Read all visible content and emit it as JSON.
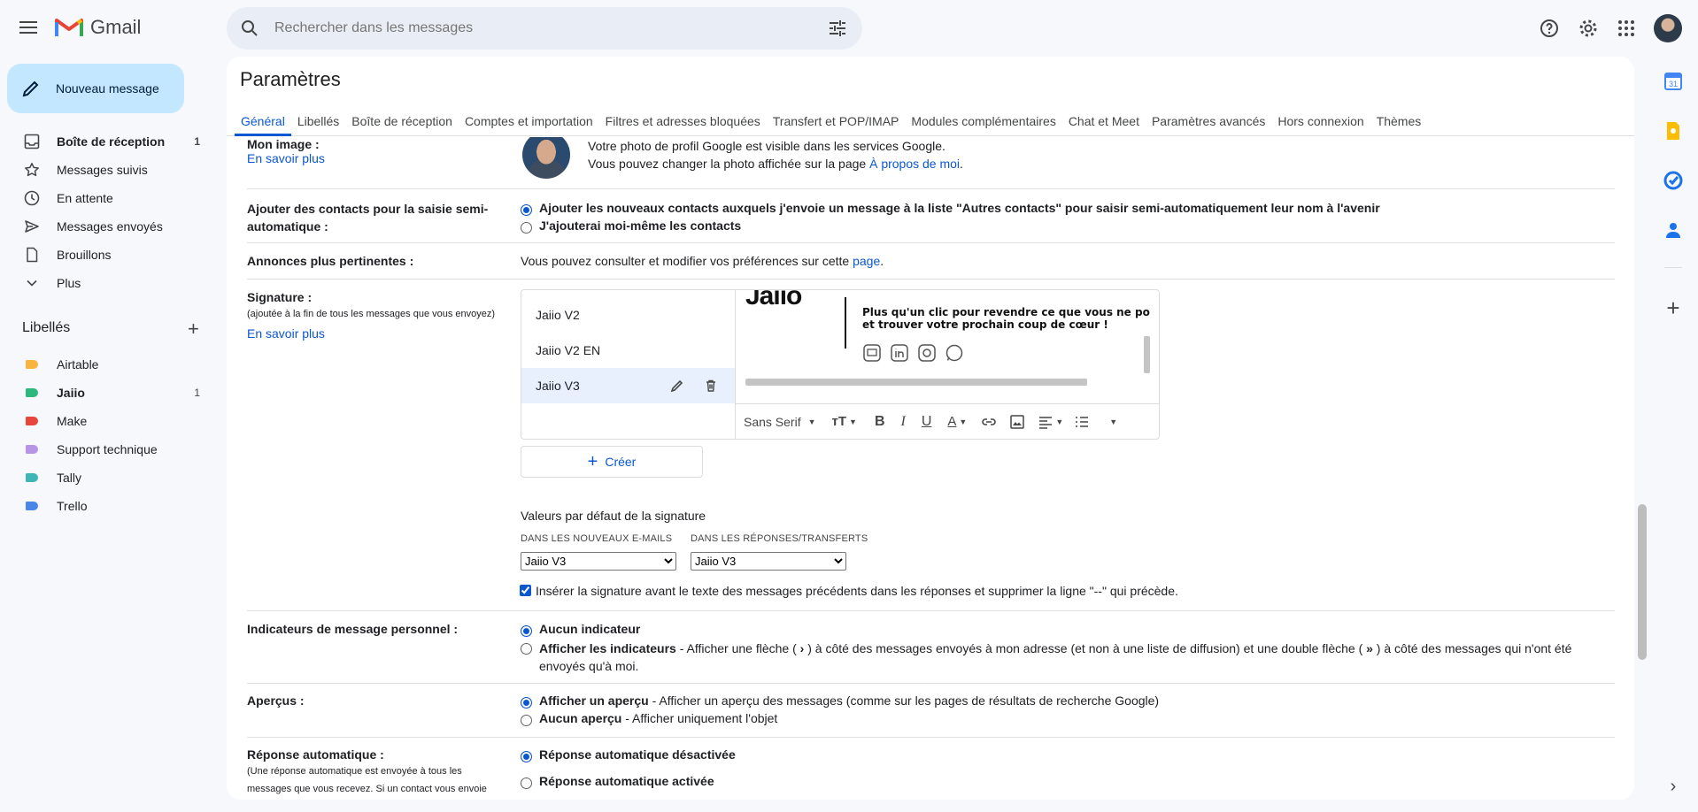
{
  "app": {
    "name": "Gmail"
  },
  "search": {
    "placeholder": "Rechercher dans les messages"
  },
  "compose": {
    "label": "Nouveau message"
  },
  "sidebar": {
    "items": [
      {
        "label": "Boîte de réception",
        "count": "1",
        "icon": "inbox-icon"
      },
      {
        "label": "Messages suivis",
        "count": "",
        "icon": "star-icon"
      },
      {
        "label": "En attente",
        "count": "",
        "icon": "clock-icon"
      },
      {
        "label": "Messages envoyés",
        "count": "",
        "icon": "send-icon"
      },
      {
        "label": "Brouillons",
        "count": "",
        "icon": "draft-icon"
      },
      {
        "label": "Plus",
        "count": "",
        "icon": "chevron-down-icon"
      }
    ],
    "labels_title": "Libellés",
    "labels": [
      {
        "label": "Airtable",
        "count": "",
        "color": "#f9b33f"
      },
      {
        "label": "Jaiio",
        "count": "1",
        "color": "#2db87d"
      },
      {
        "label": "Make",
        "count": "",
        "color": "#e8453c"
      },
      {
        "label": "Support technique",
        "count": "",
        "color": "#b694e8"
      },
      {
        "label": "Tally",
        "count": "",
        "color": "#3fb6b6"
      },
      {
        "label": "Trello",
        "count": "",
        "color": "#4a86e8"
      }
    ]
  },
  "settings": {
    "title": "Paramètres",
    "tabs": [
      "Général",
      "Libellés",
      "Boîte de réception",
      "Comptes et importation",
      "Filtres et adresses bloquées",
      "Transfert et POP/IMAP",
      "Modules complémentaires",
      "Chat et Meet",
      "Paramètres avancés",
      "Hors connexion",
      "Thèmes"
    ],
    "my_image": {
      "label": "Mon image :",
      "learn_more": "En savoir plus",
      "line1": "Votre photo de profil Google est visible dans les services Google.",
      "line2": "Vous pouvez changer la photo affichée sur la page ",
      "about_link": "À propos de moi",
      "period": "."
    },
    "contacts": {
      "label": "Ajouter des contacts pour la saisie semi-automatique :",
      "option1": "Ajouter les nouveaux contacts auxquels j'envoie un message à la liste \"Autres contacts\" pour saisir semi-automatiquement leur nom à l'avenir",
      "option2": "J'ajouterai moi-même les contacts"
    },
    "ads": {
      "label": "Annonces plus pertinentes :",
      "text": "Vous pouvez consulter et modifier vos préférences sur cette ",
      "link": "page",
      "period": "."
    },
    "signature": {
      "label": "Signature :",
      "sub": "(ajoutée à la fin de tous les messages que vous envoyez)",
      "learn_more": "En savoir plus",
      "items": [
        "Jaiio V2",
        "Jaiio V2 EN",
        "Jaiio V3"
      ],
      "preview_logo": "Jaiio",
      "preview_line1": "Plus qu'un clic pour revendre ce que vous ne po",
      "preview_line2": "et trouver votre prochain coup de cœur !",
      "font": "Sans Serif",
      "create": "Créer",
      "defaults_title": "Valeurs par défaut de la signature",
      "new_emails_caption": "DANS LES NOUVEAUX E-MAILS",
      "replies_caption": "DANS LES RÉPONSES/TRANSFERTS",
      "new_emails_value": "Jaiio V3",
      "replies_value": "Jaiio V3",
      "insert_before": "Insérer la signature avant le texte des messages précédents dans les réponses et supprimer la ligne \"--\" qui précède."
    },
    "indicators": {
      "label": "Indicateurs de message personnel :",
      "option1": "Aucun indicateur",
      "option2_bold": "Afficher les indicateurs",
      "option2_a": " - Afficher une flèche ( ",
      "arrow1": "›",
      "option2_b": " ) à côté des messages envoyés à mon adresse (et non à une liste de diffusion) et une double flèche ( ",
      "arrow2": "»",
      "option2_c": " ) à côté des messages qui n'ont été",
      "option2_d": "envoyés qu'à moi."
    },
    "preview": {
      "label": "Aperçus :",
      "option1_bold": "Afficher un aperçu",
      "option1_rest": " - Afficher un aperçu des messages (comme sur les pages de résultats de recherche Google)",
      "option2_bold": "Aucun aperçu",
      "option2_rest": " - Afficher uniquement l'objet"
    },
    "autoreply": {
      "label": "Réponse automatique :",
      "sub1": "(Une réponse automatique est envoyée à tous les",
      "sub2": "messages que vous recevez. Si un contact vous envoie",
      "option1": "Réponse automatique désactivée",
      "option2": "Réponse automatique activée"
    }
  }
}
